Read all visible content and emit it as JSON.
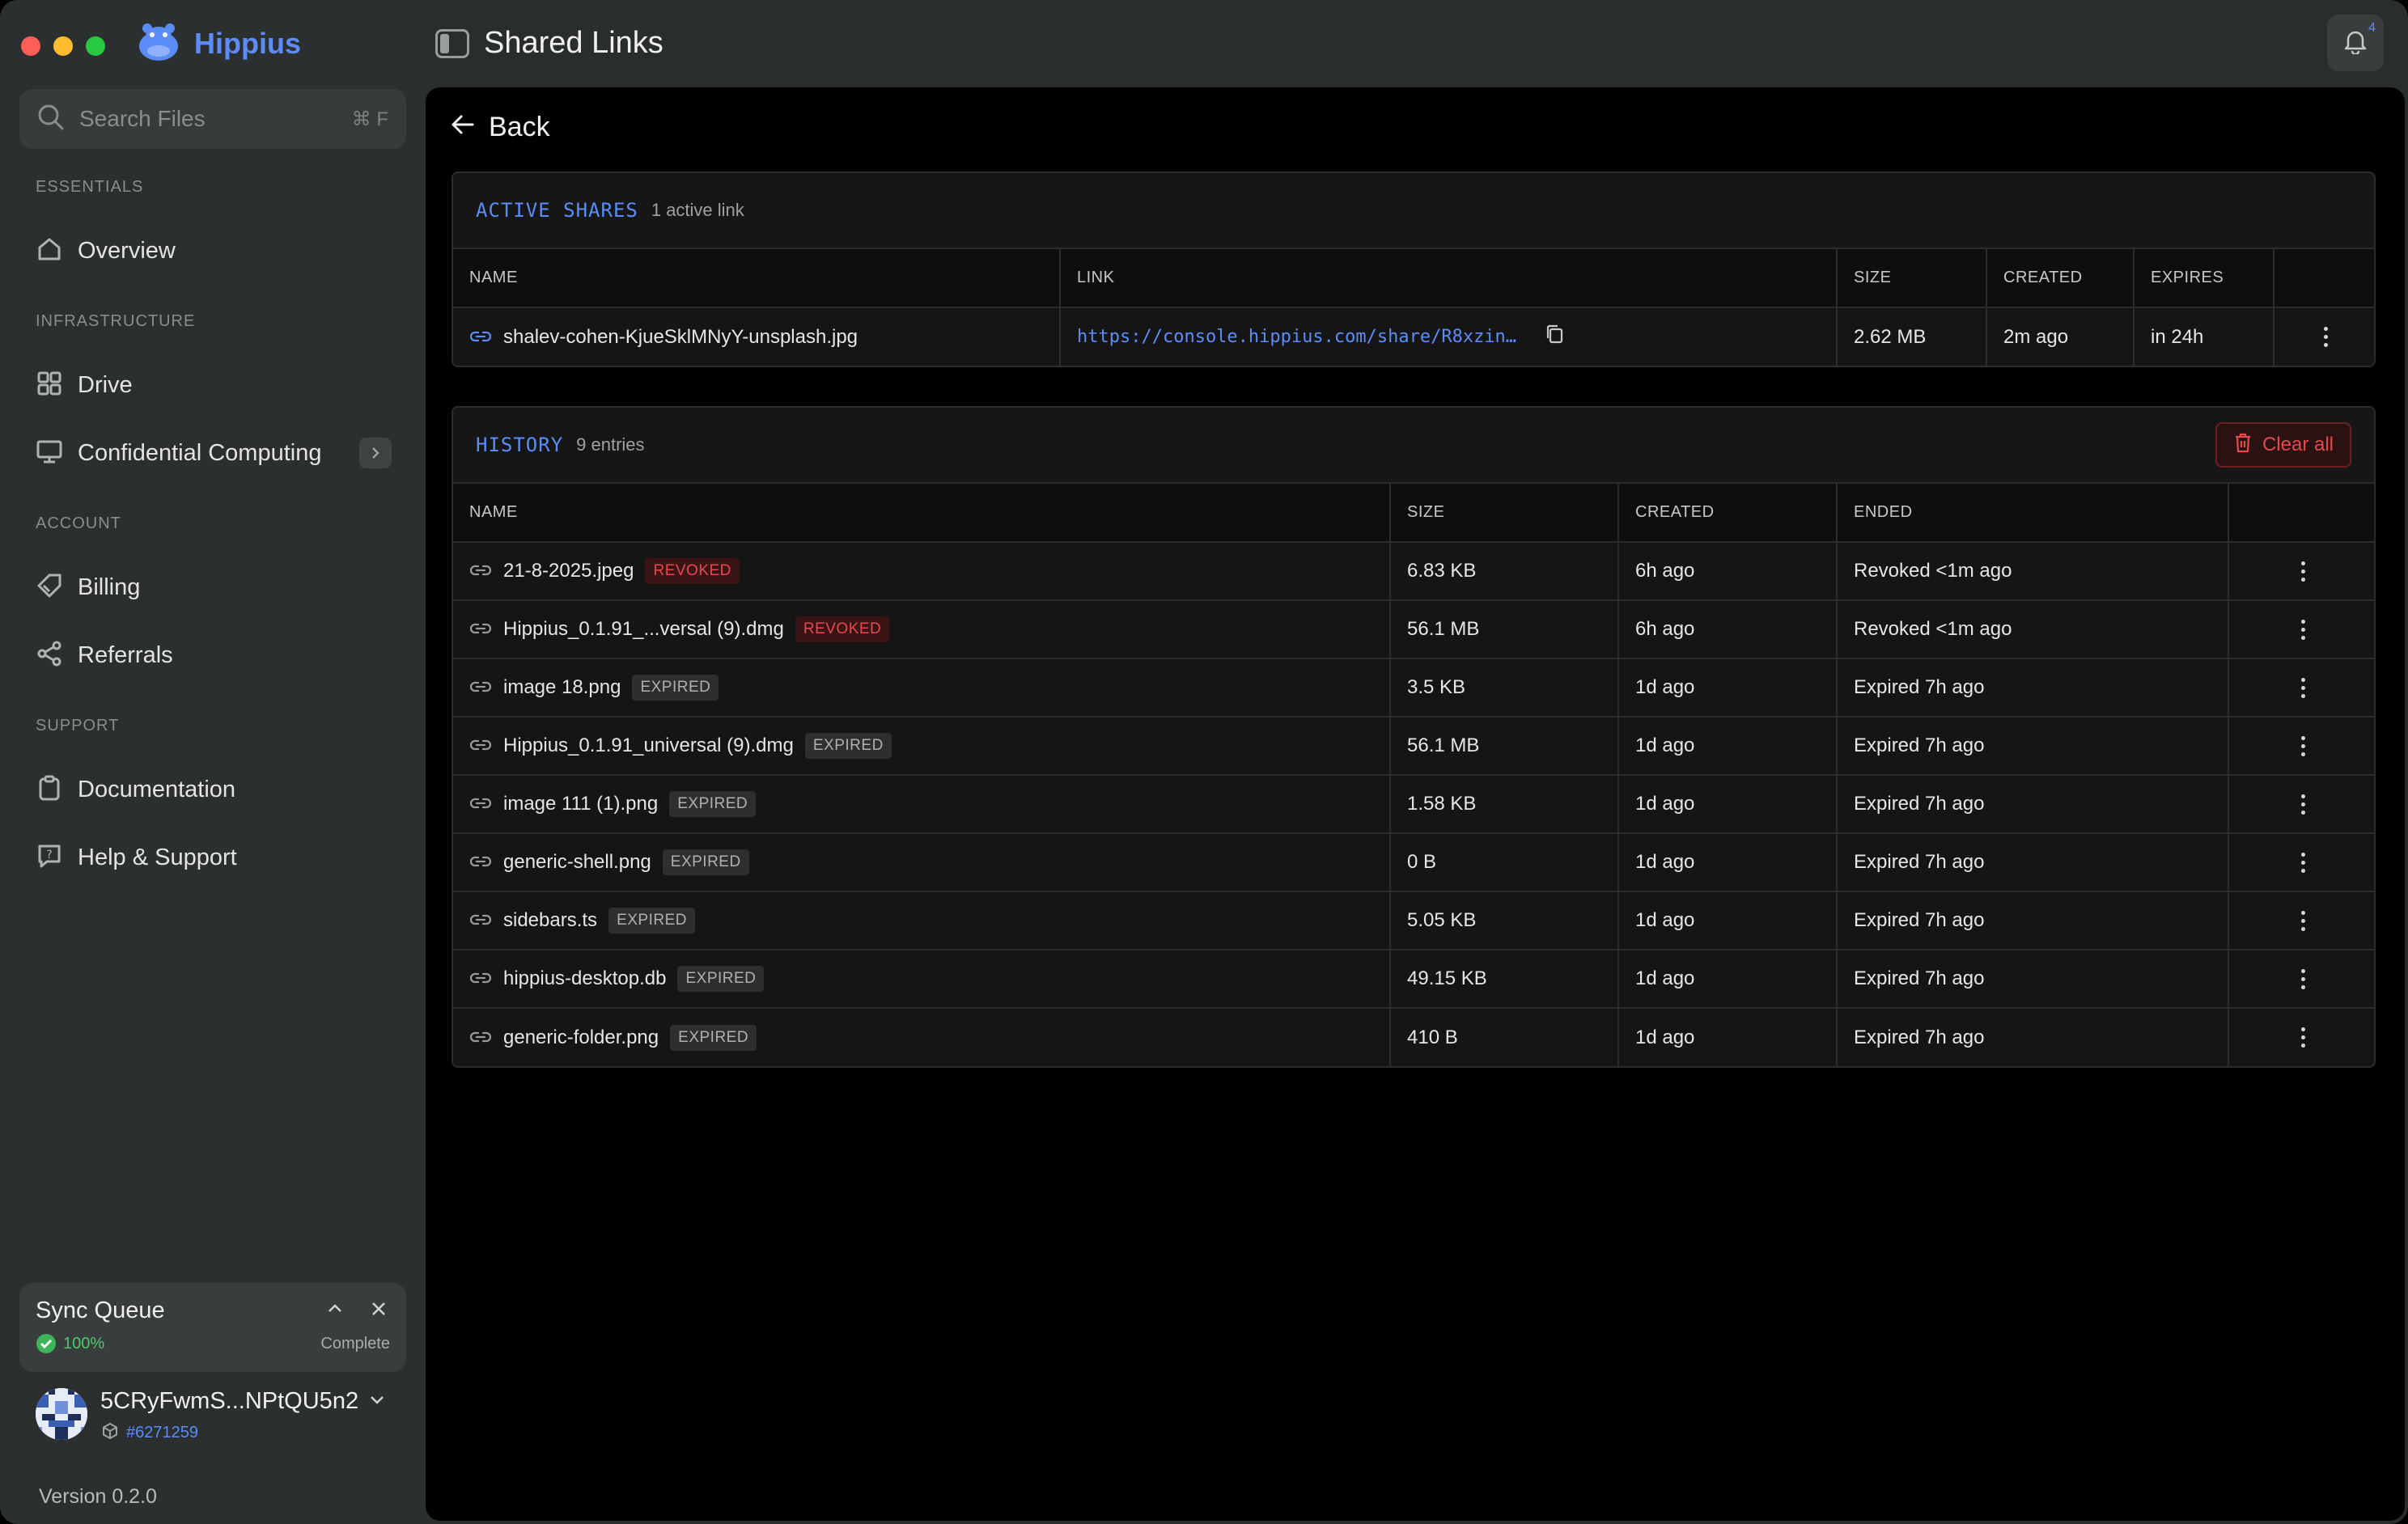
{
  "app": {
    "name": "Hippius",
    "page_title": "Shared Links"
  },
  "search": {
    "placeholder": "Search Files",
    "shortcut": "⌘ F"
  },
  "sidebar": {
    "sections": [
      {
        "label": "ESSENTIALS",
        "items": [
          {
            "label": "Overview",
            "icon": "home-icon"
          }
        ]
      },
      {
        "label": "INFRASTRUCTURE",
        "items": [
          {
            "label": "Drive",
            "icon": "grid-icon"
          },
          {
            "label": "Confidential Computing",
            "icon": "monitor-icon"
          }
        ]
      },
      {
        "label": "ACCOUNT",
        "items": [
          {
            "label": "Billing",
            "icon": "tag-icon"
          },
          {
            "label": "Referrals",
            "icon": "share-icon"
          }
        ]
      },
      {
        "label": "SUPPORT",
        "items": [
          {
            "label": "Documentation",
            "icon": "clipboard-icon"
          },
          {
            "label": "Help & Support",
            "icon": "help-icon"
          }
        ]
      }
    ]
  },
  "sync": {
    "title": "Sync Queue",
    "percent": "100%",
    "status": "Complete"
  },
  "user": {
    "name": "5CRyFwmS...NPtQU5n2",
    "id": "#6271259"
  },
  "version": "Version 0.2.0",
  "notifications": {
    "count": "4"
  },
  "back_label": "Back",
  "active_shares": {
    "title": "ACTIVE SHARES",
    "subtitle": "1 active link",
    "columns": [
      "NAME",
      "LINK",
      "SIZE",
      "CREATED",
      "EXPIRES"
    ],
    "rows": [
      {
        "name": "shalev-cohen-KjueSklMNyY-unsplash.jpg",
        "link": "https://console.hippius.com/share/R8xzin…",
        "size": "2.62 MB",
        "created": "2m ago",
        "expires": "in 24h"
      }
    ]
  },
  "history": {
    "title": "HISTORY",
    "subtitle": "9 entries",
    "clear_label": "Clear all",
    "columns": [
      "NAME",
      "SIZE",
      "CREATED",
      "ENDED"
    ],
    "rows": [
      {
        "name": "21-8-2025.jpeg",
        "badge": "REVOKED",
        "size": "6.83 KB",
        "created": "6h ago",
        "ended": "Revoked <1m ago"
      },
      {
        "name": "Hippius_0.1.91_...versal (9).dmg",
        "badge": "REVOKED",
        "size": "56.1 MB",
        "created": "6h ago",
        "ended": "Revoked <1m ago"
      },
      {
        "name": "image 18.png",
        "badge": "EXPIRED",
        "size": "3.5 KB",
        "created": "1d ago",
        "ended": "Expired 7h ago"
      },
      {
        "name": "Hippius_0.1.91_universal (9).dmg",
        "badge": "EXPIRED",
        "size": "56.1 MB",
        "created": "1d ago",
        "ended": "Expired 7h ago"
      },
      {
        "name": "image 111 (1).png",
        "badge": "EXPIRED",
        "size": "1.58 KB",
        "created": "1d ago",
        "ended": "Expired 7h ago"
      },
      {
        "name": "generic-shell.png",
        "badge": "EXPIRED",
        "size": "0 B",
        "created": "1d ago",
        "ended": "Expired 7h ago"
      },
      {
        "name": "sidebars.ts",
        "badge": "EXPIRED",
        "size": "5.05 KB",
        "created": "1d ago",
        "ended": "Expired 7h ago"
      },
      {
        "name": "hippius-desktop.db",
        "badge": "EXPIRED",
        "size": "49.15 KB",
        "created": "1d ago",
        "ended": "Expired 7h ago"
      },
      {
        "name": "generic-folder.png",
        "badge": "EXPIRED",
        "size": "410 B",
        "created": "1d ago",
        "ended": "Expired 7h ago"
      }
    ]
  },
  "colors": {
    "accent": "#5b8df8",
    "danger": "#e5484d",
    "success": "#4ccb6a"
  }
}
